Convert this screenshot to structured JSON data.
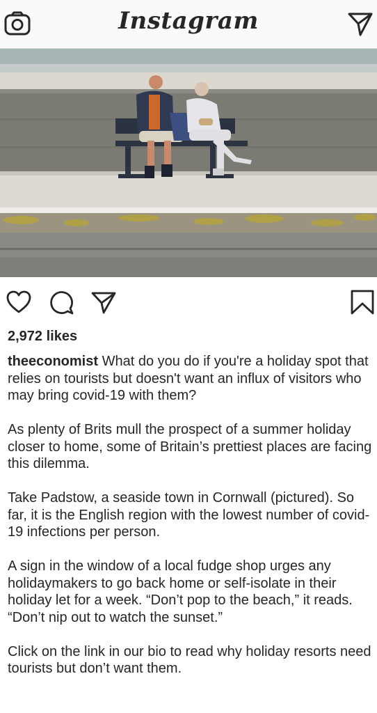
{
  "header": {
    "logo_text": "Instagram",
    "camera_icon": "camera-icon",
    "direct_icon": "paper-plane-icon"
  },
  "post": {
    "image_alt": "Photo of two people on a bench by a seawall",
    "actions": {
      "like_icon": "heart-icon",
      "comment_icon": "comment-icon",
      "share_icon": "paper-plane-icon",
      "save_icon": "bookmark-icon"
    },
    "likes": "2,972 likes",
    "caption": {
      "username": "theeconomist",
      "paragraphs": [
        "What do you do if you're a holiday spot that relies on tourists but doesn't want an influx of visitors who may bring covid-19 with them?",
        "As plenty of Brits mull the prospect of a summer holiday closer to home, some of Britain’s prettiest places are facing this dilemma.",
        "Take Padstow, a seaside town in Cornwall (pictured). So far, it is the English region with the lowest number of covid-19 infections per person.",
        "A sign in the window of a local fudge shop urges any holidaymakers to go back home or self-isolate in their holiday let for a week. “Don’t pop to the beach,” it reads. “Don’t nip out to watch the sunset.”",
        "Click on the link in our bio to read why holiday resorts need tourists but don’t want them."
      ]
    }
  },
  "colors": {
    "text": "#262626",
    "topbar_bg": "#fafafa",
    "divider": "#dbdbdb"
  }
}
